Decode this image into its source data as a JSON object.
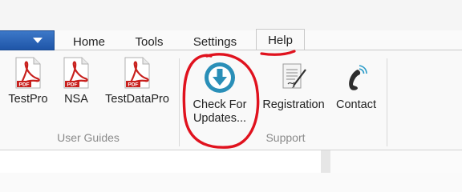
{
  "tabs": [
    {
      "label": "Home"
    },
    {
      "label": "Tools"
    },
    {
      "label": "Settings"
    },
    {
      "label": "Help",
      "active": true
    }
  ],
  "groups": {
    "user_guides": {
      "label": "User Guides",
      "buttons": [
        {
          "label": "TestPro",
          "icon": "pdf-icon"
        },
        {
          "label": "NSA",
          "icon": "pdf-icon"
        },
        {
          "label": "TestDataPro",
          "icon": "pdf-icon"
        }
      ]
    },
    "support": {
      "label": "Support",
      "buttons": [
        {
          "label_line1": "Check For",
          "label_line2": "Updates...",
          "icon": "download-icon"
        },
        {
          "label": "Registration",
          "icon": "registration-form-icon"
        },
        {
          "label": "Contact",
          "icon": "phone-icon"
        }
      ]
    }
  },
  "pdf_badge": "PDF",
  "colors": {
    "accent_blue": "#2b63b6",
    "annotation_red": "#e0121e",
    "pdf_red": "#c8201d",
    "download_teal": "#2a8fb8"
  }
}
